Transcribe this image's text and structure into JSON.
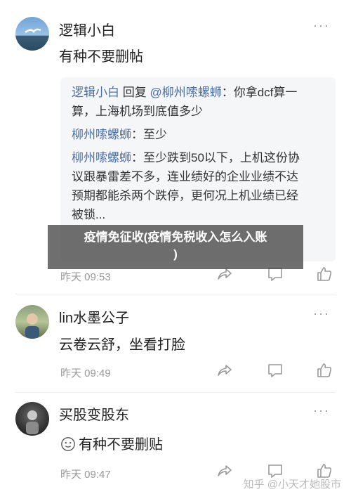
{
  "posts": [
    {
      "username": "逻辑小白",
      "text": "有种不要删帖",
      "quote": {
        "line1_user": "逻辑小白",
        "line1_mid": " 回复 ",
        "line1_target": "@柳州嗦螺蛳",
        "line1_rest": "：你拿dcf算一",
        "line2": "算，上海机场到底值多少",
        "line3_user": "柳州嗦螺蛳",
        "line3_rest": "：至少",
        "line4_user": "柳州嗦螺蛳",
        "line4_rest": "：至少跌到50以下，上机这份协",
        "line5": "议跟暴雷差不多，连业绩好的企业业绩不达",
        "line6": "预期都能杀两个跌停，更何况上机业绩已经",
        "line7": "被锁..."
      },
      "time": "昨天 09:53"
    },
    {
      "username": "lin水墨公子",
      "text": "云卷云舒，坐看打脸",
      "time": "昨天 09:49"
    },
    {
      "username": "买股变股东",
      "text": "有种不要删贴",
      "time": "昨天 09:47"
    }
  ],
  "overlay": {
    "line1": "疫情免征收(疫情免税收入怎么入账",
    "line2": ")"
  },
  "watermark": "知乎 @小天才她股市",
  "more_label": "···"
}
